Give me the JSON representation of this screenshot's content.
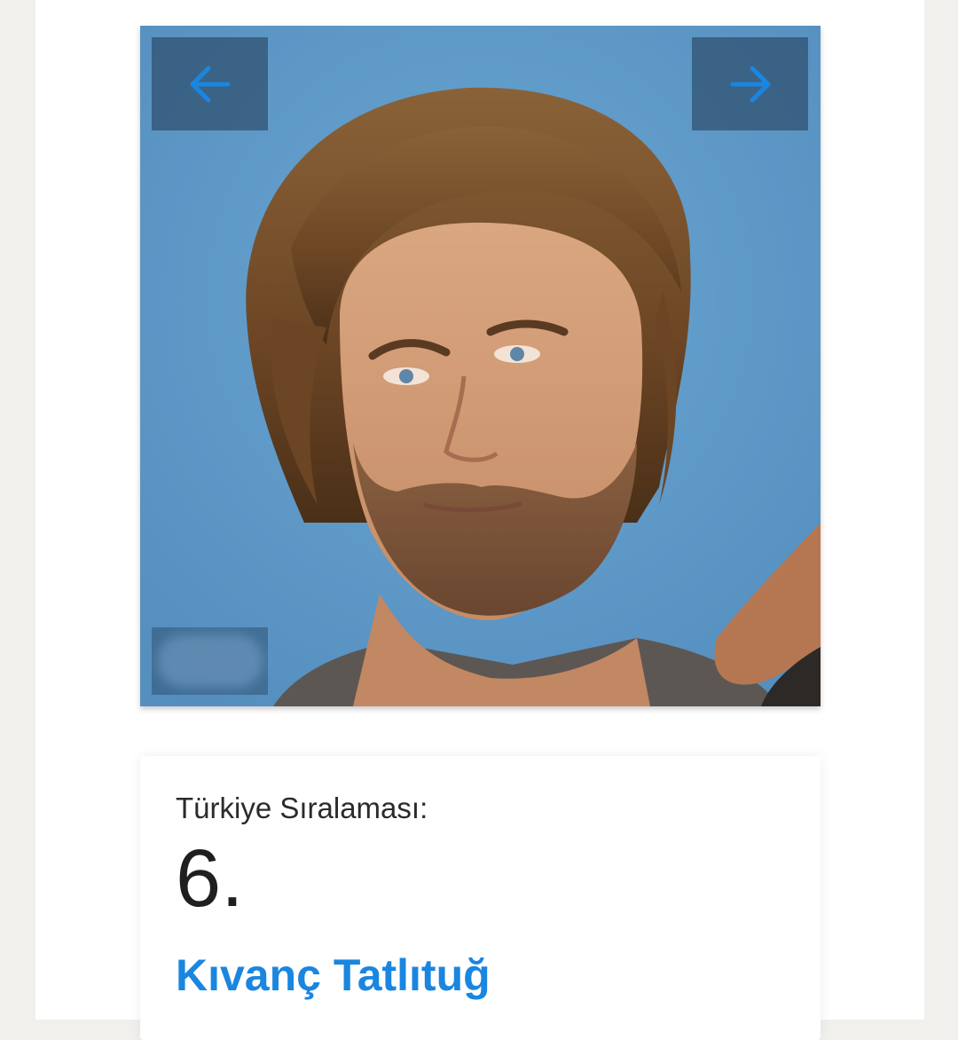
{
  "gallery": {
    "prev_icon": "arrow-left-icon",
    "next_icon": "arrow-right-icon",
    "photo": "portrait-photo",
    "arrow_color": "#1a86e0",
    "background_color": "#5f9ccb"
  },
  "ranking": {
    "label": "Türkiye Sıralaması:",
    "value": "6.",
    "name": "Kıvanç Tatlıtuğ"
  }
}
